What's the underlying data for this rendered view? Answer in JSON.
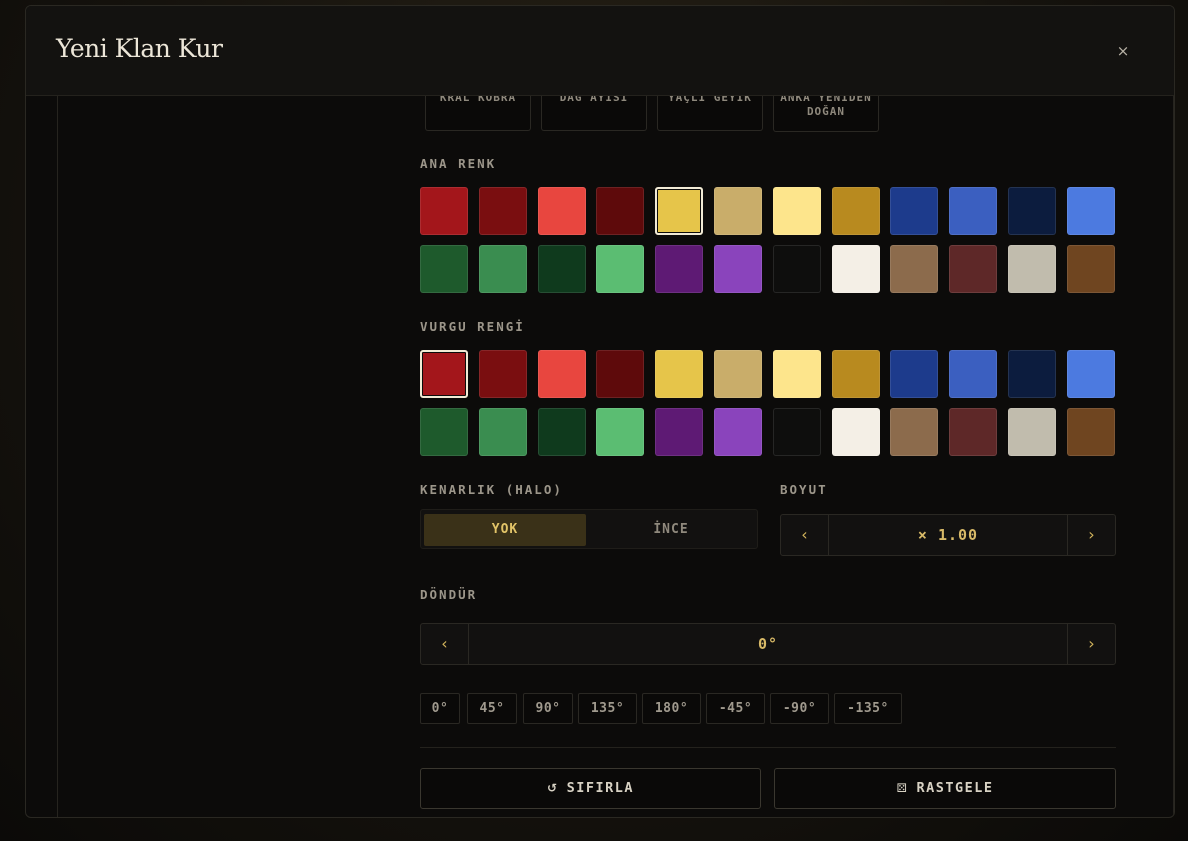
{
  "modal": {
    "title": "Yeni Klan Kur",
    "close_label": "×"
  },
  "presets": [
    "KRAL KOBRA",
    "DAĞ AYISI",
    "YAÇLI GEYİK",
    "ANKA YENİDEN DOĞAN"
  ],
  "primary_color": {
    "label": "ANA RENK",
    "selected_index": 4,
    "swatches": [
      "#a3161b",
      "#7a0e10",
      "#e8463f",
      "#5e0a0b",
      "#e6c54a",
      "#c9ad6a",
      "#fde58c",
      "#b88a1f",
      "#1d3b8c",
      "#3b5fc0",
      "#0c1c3e",
      "#4c7ae0",
      "#1e5a2c",
      "#3a8d50",
      "#0f3a1d",
      "#5bbd72",
      "#5e1a74",
      "#8a44bc",
      "#0e0e0d",
      "#f4efe6",
      "#8c6b4c",
      "#5e2828",
      "#c1bcad",
      "#6f4520"
    ]
  },
  "accent_color": {
    "label": "VURGU RENGİ",
    "selected_index": 0,
    "swatches": [
      "#a3161b",
      "#7a0e10",
      "#e8463f",
      "#5e0a0b",
      "#e6c54a",
      "#c9ad6a",
      "#fde58c",
      "#b88a1f",
      "#1d3b8c",
      "#3b5fc0",
      "#0c1c3e",
      "#4c7ae0",
      "#1e5a2c",
      "#3a8d50",
      "#0f3a1d",
      "#5bbd72",
      "#5e1a74",
      "#8a44bc",
      "#0e0e0d",
      "#f4efe6",
      "#8c6b4c",
      "#5e2828",
      "#c1bcad",
      "#6f4520"
    ]
  },
  "halo": {
    "label": "KENARLIK (HALO)",
    "options": [
      "YOK",
      "İNCE"
    ],
    "selected": "YOK"
  },
  "size": {
    "label": "BOYUT",
    "value": "× 1.00",
    "prev": "‹",
    "next": "›"
  },
  "rotate": {
    "label": "DÖNDÜR",
    "value": "0°",
    "prev": "‹",
    "next": "›",
    "presets": [
      "0°",
      "45°",
      "90°",
      "135°",
      "180°",
      "-45°",
      "-90°",
      "-135°"
    ]
  },
  "actions": {
    "reset_icon": "↺",
    "reset_label": "SIFIRLA",
    "random_icon": "⚄",
    "random_label": "RASTGELE"
  },
  "accent": "#d8ba68"
}
